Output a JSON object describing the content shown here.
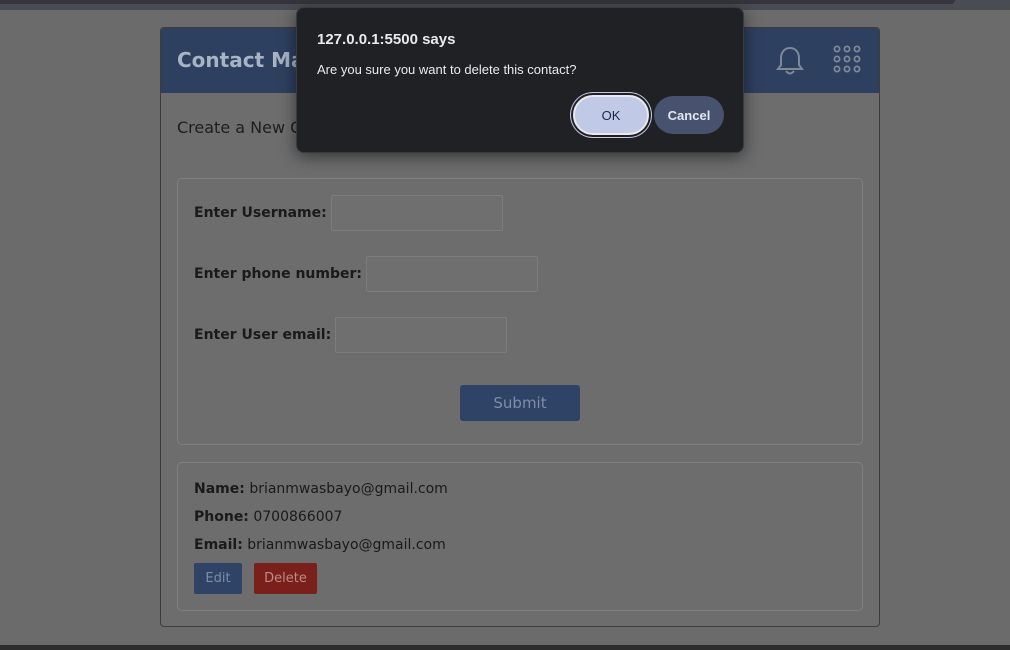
{
  "app": {
    "title": "Contact Mana",
    "section_title": "Create a New Co"
  },
  "form": {
    "username_label": "Enter Username:",
    "phone_label": "Enter phone number:",
    "email_label": "Enter User email:",
    "username_value": "",
    "phone_value": "",
    "email_value": "",
    "submit_label": "Submit"
  },
  "contact": {
    "name_label": "Name:",
    "name_value": "brianmwasbayo@gmail.com",
    "phone_label": "Phone:",
    "phone_value": "0700866007",
    "email_label": "Email:",
    "email_value": "brianmwasbayo@gmail.com",
    "edit_label": "Edit",
    "delete_label": "Delete"
  },
  "dialog": {
    "origin": "127.0.0.1:5500 says",
    "message": "Are you sure you want to delete this contact?",
    "ok_label": "OK",
    "cancel_label": "Cancel"
  },
  "icons": {
    "notifications": "bell-icon",
    "apps": "grid-icon"
  },
  "colors": {
    "header": "#2e405f",
    "primary_button": "#2e4366",
    "delete_button": "#7a1f1a",
    "dialog_bg": "#202124",
    "ok_button": "#c0c9e6",
    "cancel_button": "#47526f"
  }
}
